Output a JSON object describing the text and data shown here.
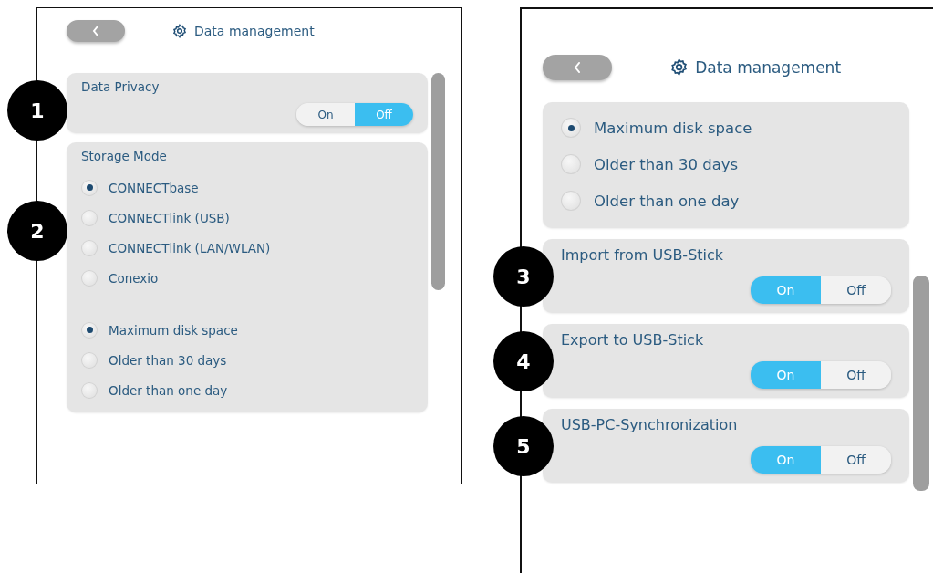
{
  "screens": [
    {
      "title": "Data management",
      "sections": [
        {
          "kind": "toggle",
          "label": "Data Privacy",
          "callout": "1",
          "options": [
            {
              "label": "On",
              "selected": false
            },
            {
              "label": "Off",
              "selected": true
            }
          ]
        },
        {
          "kind": "radio",
          "label": "Storage Mode",
          "callout": "2",
          "groups": [
            {
              "options": [
                {
                  "label": "CONNECTbase",
                  "selected": true
                },
                {
                  "label": "CONNECTlink (USB)",
                  "selected": false
                },
                {
                  "label": "CONNECTlink (LAN/WLAN)",
                  "selected": false
                },
                {
                  "label": "Conexio",
                  "selected": false
                }
              ]
            },
            {
              "options": [
                {
                  "label": "Maximum disk space",
                  "selected": true
                },
                {
                  "label": "Older than 30 days",
                  "selected": false
                },
                {
                  "label": "Older than one day",
                  "selected": false
                }
              ]
            }
          ]
        }
      ]
    },
    {
      "title": "Data management",
      "sections": [
        {
          "kind": "radio",
          "groups": [
            {
              "options": [
                {
                  "label": "Maximum disk space",
                  "selected": true
                },
                {
                  "label": "Older than 30 days",
                  "selected": false
                },
                {
                  "label": "Older than one day",
                  "selected": false
                }
              ]
            }
          ]
        },
        {
          "kind": "toggle",
          "label": "Import from USB-Stick",
          "callout": "3",
          "options": [
            {
              "label": "On",
              "selected": true
            },
            {
              "label": "Off",
              "selected": false
            }
          ]
        },
        {
          "kind": "toggle",
          "label": "Export to USB-Stick",
          "callout": "4",
          "options": [
            {
              "label": "On",
              "selected": true
            },
            {
              "label": "Off",
              "selected": false
            }
          ]
        },
        {
          "kind": "toggle",
          "label": "USB-PC-Synchronization",
          "callout": "5",
          "options": [
            {
              "label": "On",
              "selected": true
            },
            {
              "label": "Off",
              "selected": false
            }
          ]
        }
      ]
    }
  ]
}
